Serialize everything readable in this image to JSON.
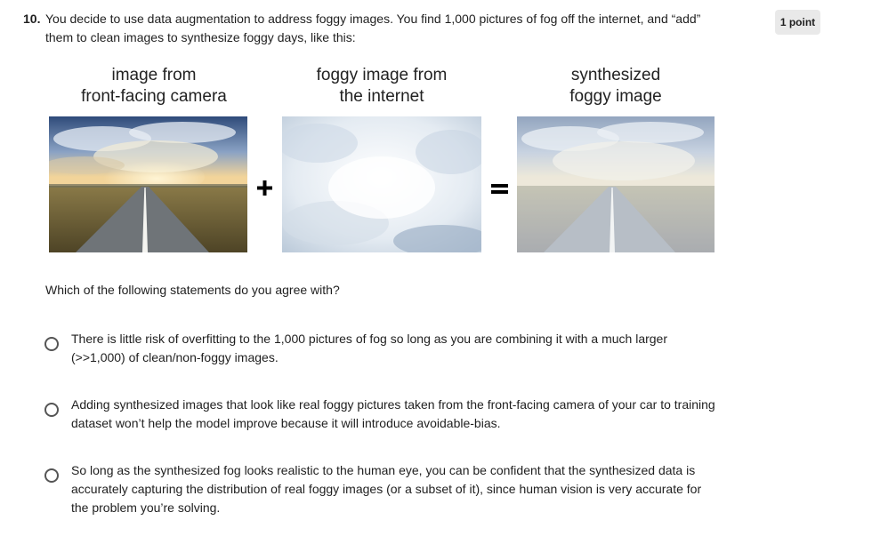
{
  "question": {
    "number": "10.",
    "text": "You decide to use data augmentation to address foggy images. You find 1,000 pictures of fog off the internet, and “add” them to clean images to synthesize foggy days, like this:",
    "points": "1 point"
  },
  "figure": {
    "captions": [
      {
        "line1": "image from",
        "line2": "front-facing camera"
      },
      {
        "line1": "foggy image from",
        "line2": "the internet"
      },
      {
        "line1": "synthesized",
        "line2": "foggy image"
      }
    ],
    "operators": [
      "plus-icon",
      "equals-icon"
    ]
  },
  "prompt": "Which of the following statements do you agree with?",
  "options": [
    {
      "text": "There is little risk of overfitting to the 1,000 pictures of fog so long as you are combining it with a much larger (>>1,000) of clean/non-foggy images."
    },
    {
      "text": "Adding synthesized images that look like real foggy pictures taken from the front-facing camera of your car to training dataset won’t help the model improve because it will introduce avoidable-bias."
    },
    {
      "text": "So long as the synthesized fog looks realistic to the human eye, you can be confident that the synthesized data is accurately capturing the distribution of real foggy images (or a subset of it), since human vision is very accurate for the problem you’re solving."
    }
  ]
}
